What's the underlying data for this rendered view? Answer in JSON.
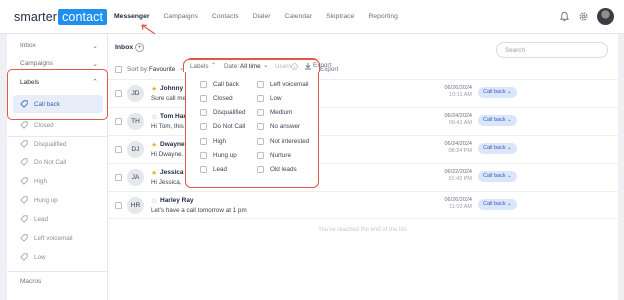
{
  "logo": {
    "left": "smarter",
    "right": "contact"
  },
  "nav": [
    "Messenger",
    "Campaigns",
    "Contacts",
    "Dialer",
    "Calendar",
    "Skiptrace",
    "Reporting"
  ],
  "sidebar": {
    "inbox": "Inbox",
    "campaigns": "Campaigns",
    "labels": "Labels",
    "macros": "Macros",
    "label_items": [
      "Call back",
      "Closed",
      "Disqualified",
      "Do Not Call",
      "High",
      "Hung up",
      "Lead",
      "Left voicemail",
      "Low"
    ]
  },
  "main": {
    "title": "Inbox",
    "search_placeholder": "Search",
    "sort_label": "Sort by:",
    "sort_value": "Favourite",
    "filter_labels": "Labels",
    "filter_date_label": "Date:",
    "filter_date_value": "All time",
    "filter_users": "Users",
    "export": "Export",
    "end_note": "You've reached the end of the list."
  },
  "messages": [
    {
      "initials": "JD",
      "starred": true,
      "name": "Johnny De",
      "text": "Sure call me at",
      "date": "06/26/2024",
      "time": "10:11 AM",
      "label": "Call back"
    },
    {
      "initials": "TH",
      "starred": false,
      "name": "Tom Hanks",
      "text": "Hi Tom, this is                          on 812 Maple Ln is it yours?",
      "date": "06/24/2024",
      "time": "09:41 AM",
      "label": "Call back"
    },
    {
      "initials": "DJ",
      "starred": true,
      "name": "Dwayne Jo",
      "text": "Hi Dwayne. I",
      "date": "06/24/2024",
      "time": "08:24 PM",
      "label": "Call back"
    },
    {
      "initials": "JA",
      "starred": true,
      "name": "Jessica Al",
      "text": "Hi Jessica,  th                                       it yours?",
      "date": "06/22/2024",
      "time": "01:43 PM",
      "label": "Call back"
    },
    {
      "initials": "HR",
      "starred": false,
      "name": "Harley Ray",
      "text": "Let's have a call tomorrow at 1 pm",
      "date": "06/26/2024",
      "time": "11:02 AM",
      "label": "Call back"
    }
  ],
  "dropdown": {
    "left_col": [
      "Call back",
      "Closed",
      "Disqualified",
      "Do Not Call",
      "High",
      "Hung up",
      "Lead"
    ],
    "right_col": [
      "Left voicemail",
      "Low",
      "Medium",
      "No answer",
      "Not interested",
      "Nurture",
      "Old leads"
    ]
  },
  "colors": {
    "accent": "#1f8ff0",
    "highlight_border": "#e0584a",
    "star": "#f2b233",
    "pill_bg": "#dbe6fb"
  }
}
